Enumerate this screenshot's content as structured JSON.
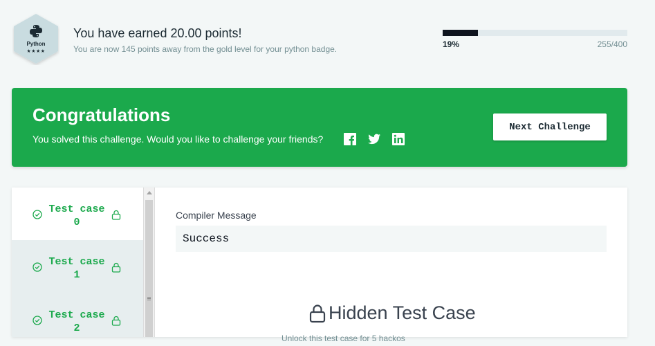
{
  "badge": {
    "name": "Python",
    "stars": "★★★★",
    "icon": "python-logo-icon"
  },
  "earned": {
    "title": "You have earned 20.00 points!",
    "subtitle": "You are now 145 points away from the gold level for your python badge."
  },
  "progress": {
    "percent_label": "19%",
    "count_label": "255/400",
    "fraction": 0.19
  },
  "banner": {
    "title": "Congratulations",
    "message": "You solved this challenge. Would you like to challenge your friends?",
    "social_icons": [
      "facebook-icon",
      "twitter-icon",
      "linkedin-icon"
    ],
    "next_button": "Next Challenge",
    "color": "#1ba94c"
  },
  "test_cases": [
    {
      "line1": "Test case",
      "line2": "0",
      "status": "passed",
      "locked": true,
      "active": true
    },
    {
      "line1": "Test case",
      "line2": "1",
      "status": "passed",
      "locked": true,
      "active": false
    },
    {
      "line1": "Test case",
      "line2": "2",
      "status": "passed",
      "locked": true,
      "active": false
    }
  ],
  "compiler": {
    "label": "Compiler Message",
    "value": "Success"
  },
  "hidden": {
    "title": "Hidden Test Case",
    "partial_text": "Unlock this test case for 5 hackos"
  }
}
